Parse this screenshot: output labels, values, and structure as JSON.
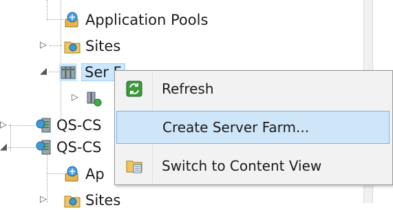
{
  "tree": {
    "nodes": [
      {
        "label": "Application Pools",
        "icon": "app-pools-icon"
      },
      {
        "label": "Sites",
        "icon": "sites-icon"
      },
      {
        "label": "Ser    F",
        "icon": "server-farms-icon"
      },
      {
        "label": "",
        "icon": "server-farm-icon"
      },
      {
        "label": "QS-CS",
        "icon": "server-icon"
      },
      {
        "label": "QS-CS",
        "icon": "server-icon"
      },
      {
        "label": "Ap",
        "icon": "app-pools-icon"
      },
      {
        "label": "Sites",
        "icon": "sites-icon"
      }
    ]
  },
  "context_menu": {
    "items": [
      {
        "label": "Refresh",
        "icon": "refresh-icon"
      },
      {
        "label": "Create Server Farm...",
        "icon": ""
      },
      {
        "label": "Switch to Content View",
        "icon": "content-view-icon"
      }
    ]
  },
  "colors": {
    "selection_bg": "#cfe6f9",
    "selection_border": "#6fb6ec",
    "menu_bg": "#f2f2f2"
  }
}
